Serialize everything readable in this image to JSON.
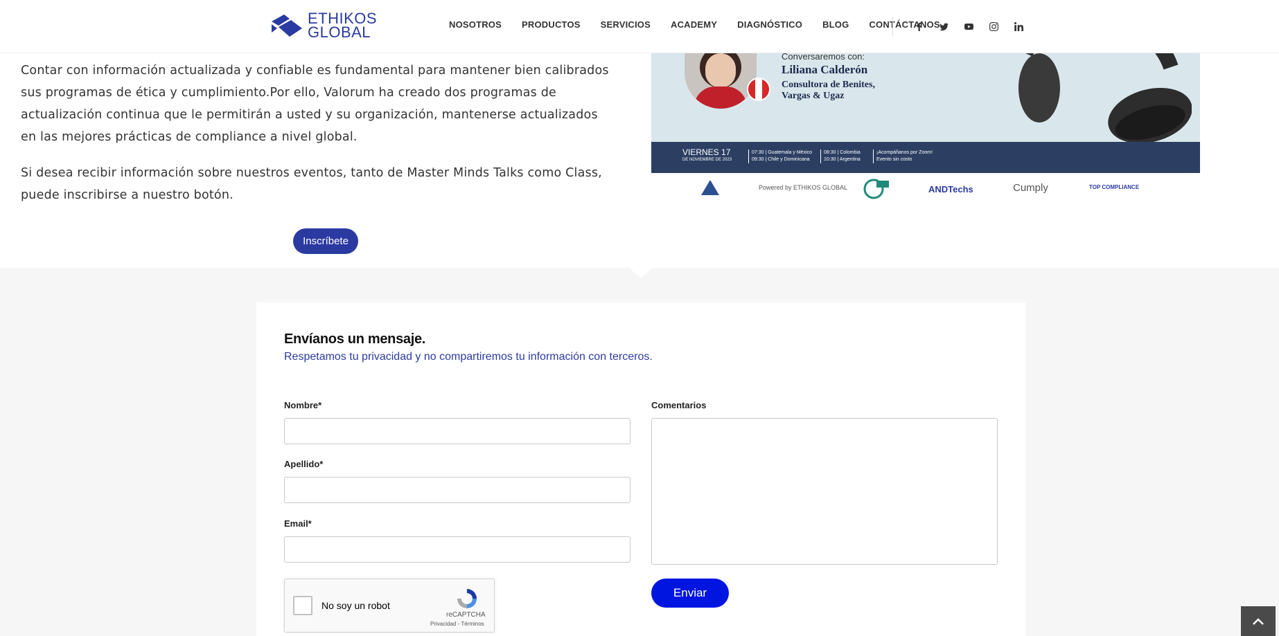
{
  "header": {
    "logo_line1": "ETHIKOS",
    "logo_line2": "GLOBAL",
    "nav": [
      "NOSOTROS",
      "PRODUCTOS",
      "SERVICIOS",
      "ACADEMY",
      "DIAGNÓSTICO",
      "BLOG",
      "CONTÁCTANOS"
    ],
    "social_icons": [
      "facebook-icon",
      "twitter-icon",
      "youtube-icon",
      "instagram-icon",
      "linkedin-icon"
    ]
  },
  "intro": {
    "paragraph1": "Contar con información actualizada y confiable es fundamental para mantener bien calibrados sus programas de ética y cumplimiento.Por ello, Valorum ha creado dos programas de actualización continua que le permitirán a usted y su organización, mantenerse actualizados en las mejores prácticas de compliance a nivel global.",
    "paragraph2": "Si desea recibir información sobre nuestros eventos, tanto de Master Minds Talks como Class, puede inscribirse a nuestro botón.",
    "button": "Inscríbete"
  },
  "banner": {
    "conversation": "Conversaremos con:",
    "speaker": "Liliana Calderón",
    "role": "Consultora de Benites, Vargas & Ugaz",
    "day": "VIERNES 17",
    "date": "DE NOVIEMBRE DE 2023",
    "times1": "07:30 | Guatemala y México",
    "times2": "09:30 | Chile y Dominicana",
    "times3": "08:30 | Colombia",
    "times4": "10:30 | Argentina",
    "zoom1": "¡Acompáñanos por Zoom!",
    "zoom2": "Evento sin costo",
    "sponsors": [
      "Powered by ETHIKOS GLOBAL",
      "ANDTechs",
      "Cumply",
      "TOP COMPLIANCE"
    ]
  },
  "form": {
    "title": "Envíanos un mensaje.",
    "subtitle": "Respetamos tu privacidad y no compartiremos tu información con terceros.",
    "nombre_label": "Nombre*",
    "apellido_label": "Apellido*",
    "email_label": "Email*",
    "comentarios_label": "Comentarios",
    "submit": "Enviar"
  },
  "recaptcha": {
    "label": "No soy un robot",
    "brand": "reCAPTCHA",
    "terms": "Privacidad - Términos"
  },
  "colors": {
    "brand_blue": "#2b3aa0",
    "submit_blue": "#0015e0",
    "banner_bar": "#2c3f63"
  }
}
